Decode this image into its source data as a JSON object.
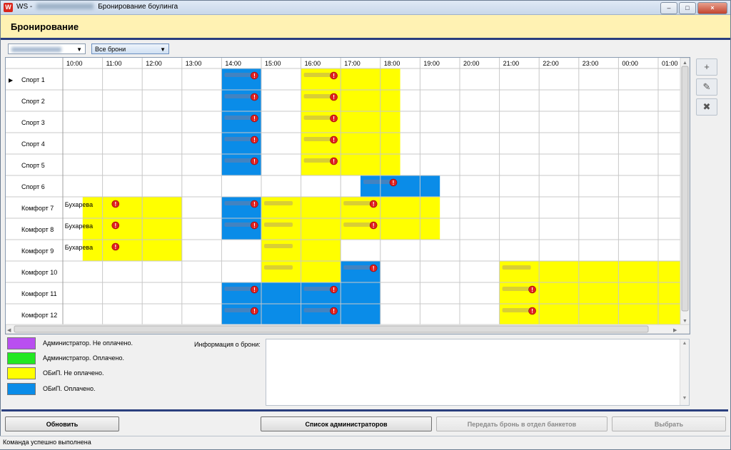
{
  "window": {
    "app_name": "WS -",
    "title": "Бронирование боулинга",
    "minimize": "–",
    "maximize": "□",
    "close": "×"
  },
  "header": {
    "title": "Бронирование"
  },
  "filters": {
    "filter_selected": "Все брони"
  },
  "schedule": {
    "times": [
      "10:00",
      "11:00",
      "12:00",
      "13:00",
      "14:00",
      "15:00",
      "16:00",
      "17:00",
      "18:00",
      "19:00",
      "20:00",
      "21:00",
      "22:00",
      "23:00",
      "00:00",
      "01:00"
    ],
    "lanes": [
      "Спорт 1",
      "Спорт 2",
      "Спорт 3",
      "Спорт 4",
      "Спорт 5",
      "Спорт 6",
      "Комфорт 7",
      "Комфорт 8",
      "Комфорт 9",
      "Комфорт 10",
      "Комфорт 11",
      "Комфорт 12"
    ],
    "current_row_marker": "▶",
    "alert_mark": "!",
    "colors": {
      "blue": "#0a8ce8",
      "yellow": "#ffff00",
      "grid": "#c8c8c8"
    },
    "bookings": [
      {
        "row": 0,
        "start": 4,
        "end": 5,
        "color": "blue",
        "name": "",
        "alert": true
      },
      {
        "row": 1,
        "start": 4,
        "end": 5,
        "color": "blue",
        "name": "",
        "alert": true
      },
      {
        "row": 2,
        "start": 4,
        "end": 5,
        "color": "blue",
        "name": "",
        "alert": true
      },
      {
        "row": 3,
        "start": 4,
        "end": 5,
        "color": "blue",
        "name": "",
        "alert": true
      },
      {
        "row": 4,
        "start": 4,
        "end": 5,
        "color": "blue",
        "name": "",
        "alert": true
      },
      {
        "row": 0,
        "start": 6,
        "end": 8.5,
        "color": "yellow",
        "name": "",
        "alert": true
      },
      {
        "row": 1,
        "start": 6,
        "end": 8.5,
        "color": "yellow",
        "name": "",
        "alert": true
      },
      {
        "row": 2,
        "start": 6,
        "end": 8.5,
        "color": "yellow",
        "name": "",
        "alert": true
      },
      {
        "row": 3,
        "start": 6,
        "end": 8.5,
        "color": "yellow",
        "name": "",
        "alert": true
      },
      {
        "row": 4,
        "start": 6,
        "end": 8.5,
        "color": "yellow",
        "name": "",
        "alert": true
      },
      {
        "row": 5,
        "start": 7.5,
        "end": 9.5,
        "color": "blue",
        "name": "",
        "alert": true
      },
      {
        "row": 6,
        "start": 0.5,
        "end": 3,
        "color": "yellow",
        "name": "Бухарева",
        "alert": true
      },
      {
        "row": 7,
        "start": 0.5,
        "end": 3,
        "color": "yellow",
        "name": "Бухарева",
        "alert": true
      },
      {
        "row": 8,
        "start": 0.5,
        "end": 3,
        "color": "yellow",
        "name": "Бухарева",
        "alert": true
      },
      {
        "row": 6,
        "start": 4,
        "end": 5,
        "color": "blue",
        "name": "",
        "alert": true
      },
      {
        "row": 7,
        "start": 4,
        "end": 5,
        "color": "blue",
        "name": "",
        "alert": true
      },
      {
        "row": 6,
        "start": 5,
        "end": 7,
        "color": "yellow",
        "name": "",
        "alert": false
      },
      {
        "row": 7,
        "start": 5,
        "end": 7,
        "color": "yellow",
        "name": "",
        "alert": false
      },
      {
        "row": 8,
        "start": 5,
        "end": 7,
        "color": "yellow",
        "name": "",
        "alert": false
      },
      {
        "row": 9,
        "start": 5,
        "end": 7,
        "color": "yellow",
        "name": "",
        "alert": false
      },
      {
        "row": 6,
        "start": 7,
        "end": 9.5,
        "color": "yellow",
        "name": "",
        "alert": true
      },
      {
        "row": 7,
        "start": 7,
        "end": 9.5,
        "color": "yellow",
        "name": "",
        "alert": true
      },
      {
        "row": 9,
        "start": 7,
        "end": 8,
        "color": "blue",
        "name": "",
        "alert": true
      },
      {
        "row": 10,
        "start": 4,
        "end": 6,
        "color": "blue",
        "name": "",
        "alert": true
      },
      {
        "row": 11,
        "start": 4,
        "end": 6,
        "color": "blue",
        "name": "",
        "alert": true
      },
      {
        "row": 10,
        "start": 6,
        "end": 8,
        "color": "blue",
        "name": "",
        "alert": true
      },
      {
        "row": 11,
        "start": 6,
        "end": 8,
        "color": "blue",
        "name": "",
        "alert": true
      },
      {
        "row": 9,
        "start": 11,
        "end": 16,
        "color": "yellow",
        "name": "",
        "alert": false
      },
      {
        "row": 10,
        "start": 11,
        "end": 16,
        "color": "yellow",
        "name": "",
        "alert": true
      },
      {
        "row": 11,
        "start": 11,
        "end": 16,
        "color": "yellow",
        "name": "",
        "alert": true
      }
    ]
  },
  "side_buttons": {
    "add": "+",
    "edit": "✎",
    "delete": "✖"
  },
  "legend": [
    {
      "color": "#b94ff0",
      "label": "Администратор. Не оплачено."
    },
    {
      "color": "#22e822",
      "label": "Администратор. Оплачено."
    },
    {
      "color": "#ffff00",
      "label": "ОБиП. Не оплачено."
    },
    {
      "color": "#0a8ce8",
      "label": "ОБиП. Оплачено."
    }
  ],
  "info": {
    "label": "Информация о брони:",
    "scroll_up": "▲",
    "scroll_down": "▼"
  },
  "buttons": {
    "refresh": "Обновить",
    "admins": "Список администраторов",
    "transfer": "Передать бронь в отдел банкетов",
    "select": "Выбрать"
  },
  "status": {
    "text": "Команда успешно выполнена"
  }
}
